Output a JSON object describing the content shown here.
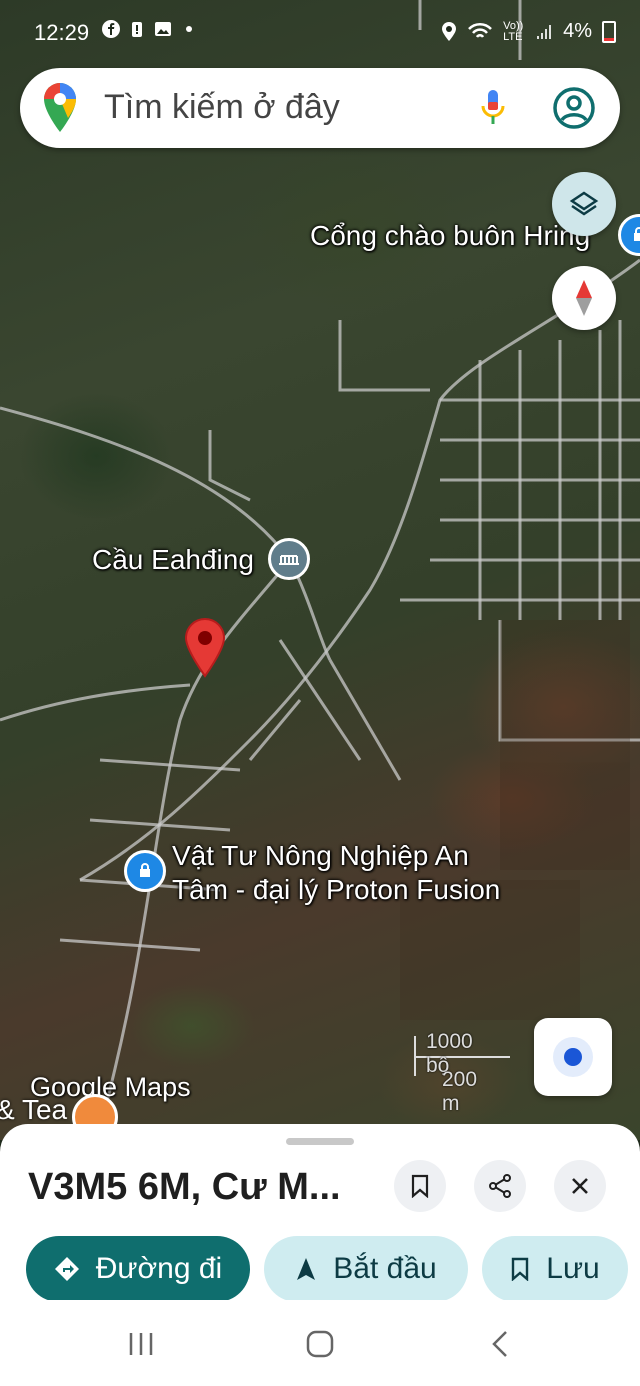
{
  "status_bar": {
    "time": "12:29",
    "network_label": "Vo)) LTE",
    "battery": "4%"
  },
  "search": {
    "placeholder": "Tìm kiếm ở đây"
  },
  "map": {
    "labels": {
      "cong_chao": "Cổng chào buôn Hring",
      "cau": "Cầu Eahđing",
      "vat_tu_line1": "Vật Tư Nông Nghiệp An",
      "vat_tu_line2": "Tâm - đại lý Proton Fusion",
      "tea": "& Tea"
    },
    "scale": {
      "feet": "1000 bộ",
      "meters": "200 m"
    },
    "logo": "Google Maps",
    "colors": {
      "pin": "#e53935",
      "poi_shopping": "#1e88e5",
      "poi_landmark": "#607d8b",
      "accent": "#0f6e6e"
    }
  },
  "place_sheet": {
    "title": "V3M5 6M, Cư M...",
    "buttons": {
      "directions": "Đường đi",
      "start": "Bắt đầu",
      "save": "Lưu"
    }
  },
  "icons": [
    "facebook-icon",
    "battery-alert-icon",
    "gallery-icon",
    "location-icon",
    "wifi-icon",
    "signal-icon",
    "mic-icon",
    "account-icon",
    "layers-icon",
    "compass-icon",
    "my-location-icon",
    "bookmark-icon",
    "share-icon",
    "close-icon",
    "directions-icon",
    "navigation-icon"
  ]
}
